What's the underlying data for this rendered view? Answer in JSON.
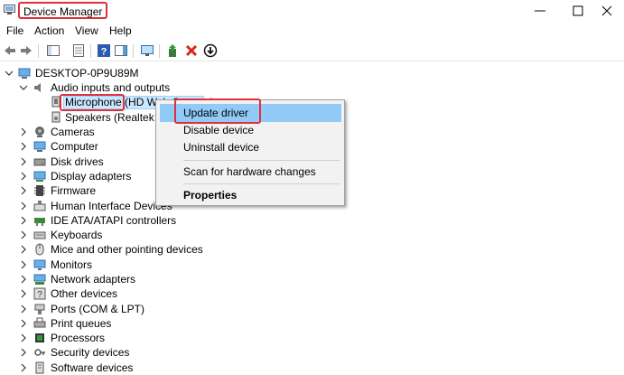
{
  "window": {
    "title": "Device Manager"
  },
  "menu": {
    "items": [
      "File",
      "Action",
      "View",
      "Help"
    ]
  },
  "tree": {
    "root": "DESKTOP-0P9U89M",
    "expanded": {
      "label": "Audio inputs and outputs",
      "children": [
        "Microphone (HD Web Camera)",
        "Speakers (Realtek High Definition Audio)"
      ]
    },
    "categories": [
      "Cameras",
      "Computer",
      "Disk drives",
      "Display adapters",
      "Firmware",
      "Human Interface Devices",
      "IDE ATA/ATAPI controllers",
      "Keyboards",
      "Mice and other pointing devices",
      "Monitors",
      "Network adapters",
      "Other devices",
      "Ports (COM & LPT)",
      "Print queues",
      "Processors",
      "Security devices",
      "Software devices"
    ]
  },
  "context_menu": {
    "items": [
      "Update driver",
      "Disable device",
      "Uninstall device",
      "Scan for hardware changes",
      "Properties"
    ]
  },
  "colors": {
    "highlight": "#91c9f7",
    "annotation_red": "#e0303a",
    "remove_red": "#d9261c"
  }
}
